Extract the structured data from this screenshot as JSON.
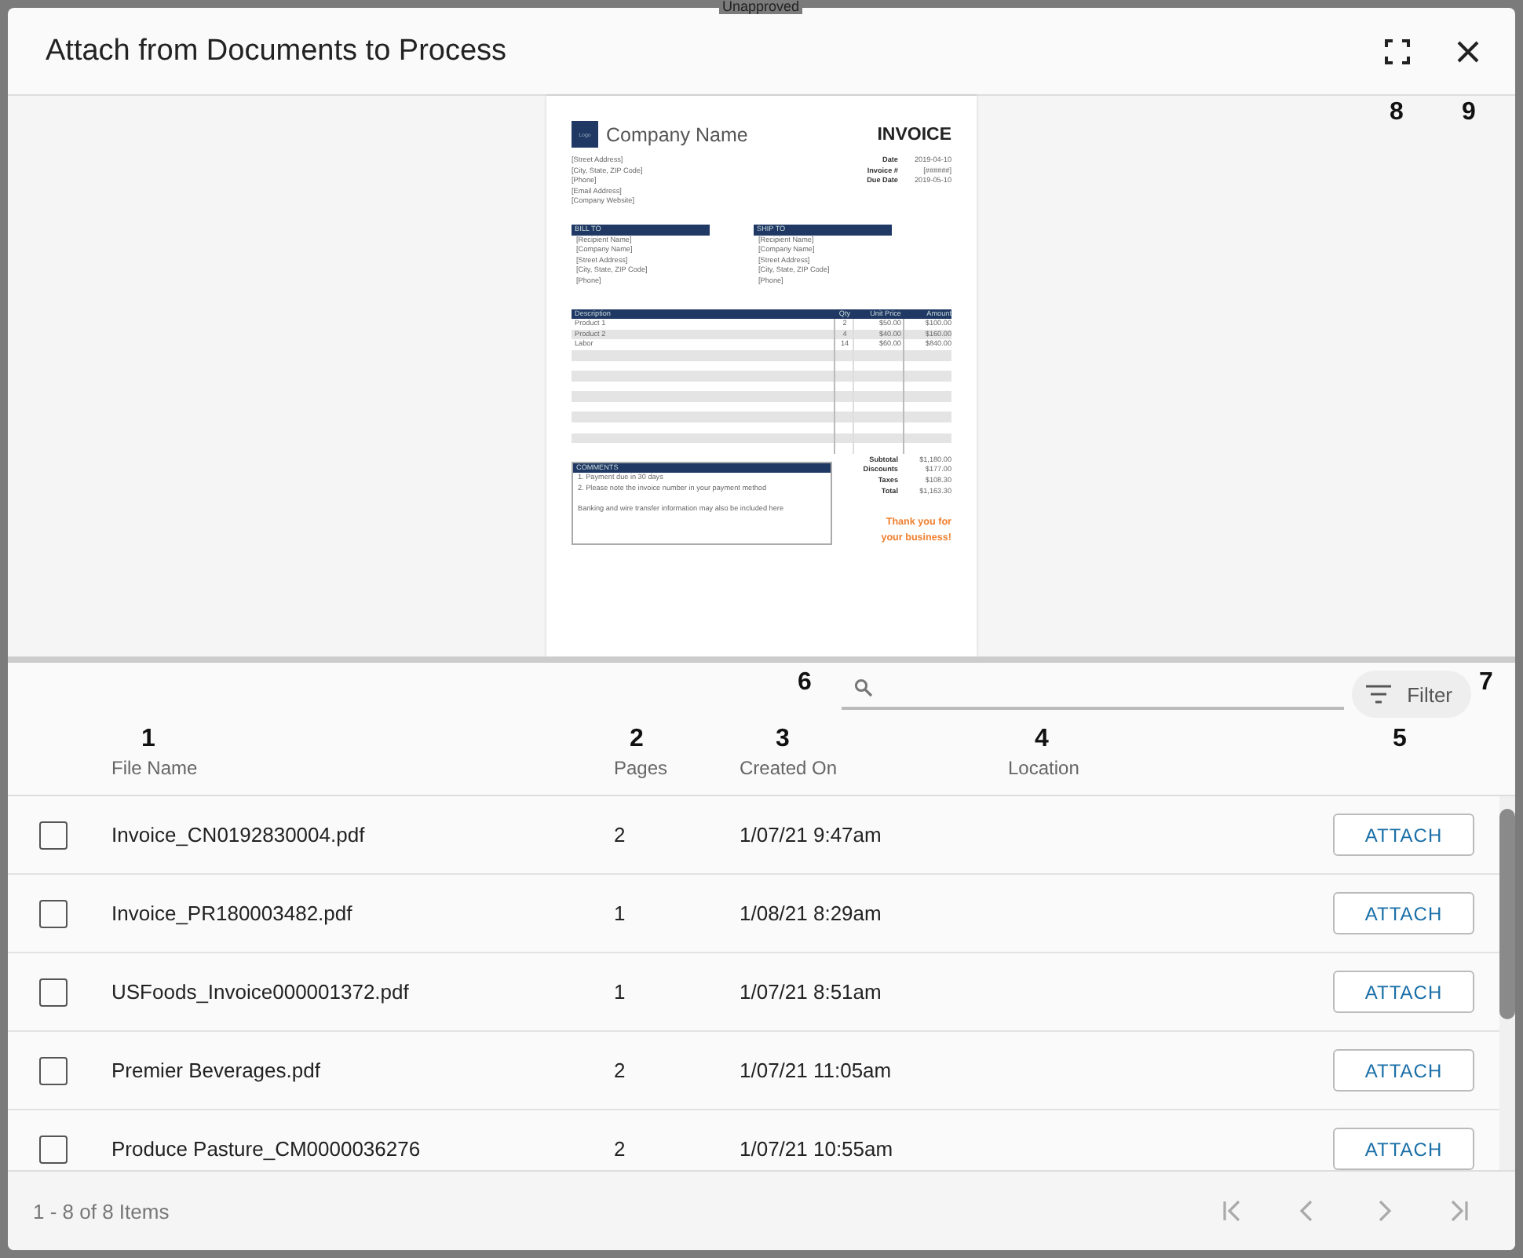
{
  "background": {
    "status_text": "Unapproved"
  },
  "dialog": {
    "title": "Attach from Documents to Process"
  },
  "preview": {
    "company_name": "Company Name",
    "logo_text": "Logo",
    "doc_title": "INVOICE",
    "address_lines": [
      "[Street Address]",
      "[City, State, ZIP Code]",
      "[Phone]",
      "[Email Address]",
      "[Company Website]"
    ],
    "meta": [
      {
        "label": "Date",
        "value": "2019-04-10"
      },
      {
        "label": "Invoice #",
        "value": "[######]"
      },
      {
        "label": "Due Date",
        "value": "2019-05-10"
      }
    ],
    "bill_to": {
      "heading": "BILL TO",
      "lines": [
        "[Recipient Name]",
        "[Company Name]",
        "[Street Address]",
        "[City, State, ZIP Code]",
        "[Phone]"
      ]
    },
    "ship_to": {
      "heading": "SHIP TO",
      "lines": [
        "[Recipient Name]",
        "[Company Name]",
        "[Street Address]",
        "[City, State, ZIP Code]",
        "[Phone]"
      ]
    },
    "items_columns": [
      "Description",
      "Qty",
      "Unit Price",
      "Amount"
    ],
    "items": [
      [
        "Product 1",
        "2",
        "$50.00",
        "$100.00"
      ],
      [
        "Product 2",
        "4",
        "$40.00",
        "$160.00"
      ],
      [
        "Labor",
        "14",
        "$60.00",
        "$840.00"
      ]
    ],
    "comments": {
      "heading": "COMMENTS",
      "lines": [
        "1. Payment due in 30 days",
        "2. Please note the invoice number in your payment method"
      ],
      "note": "Banking and wire transfer information may also be included here"
    },
    "totals": [
      {
        "label": "Subtotal",
        "value": "$1,180.00"
      },
      {
        "label": "Discounts",
        "value": "$177.00"
      },
      {
        "label": "Taxes",
        "value": "$108.30"
      },
      {
        "label": "Total",
        "value": "$1,163.30"
      }
    ],
    "thanks": [
      "Thank you for",
      "your business!"
    ]
  },
  "toolbar": {
    "filter_label": "Filter"
  },
  "table": {
    "columns": [
      "File Name",
      "Pages",
      "Created On",
      "Location"
    ],
    "rows": [
      {
        "checked": false,
        "file_name": "Invoice_CN0192830004.pdf",
        "pages": "2",
        "created_on": "1/07/21 9:47am",
        "action": "ATTACH"
      },
      {
        "checked": false,
        "file_name": "Invoice_PR180003482.pdf",
        "pages": "1",
        "created_on": "1/08/21 8:29am",
        "action": "ATTACH"
      },
      {
        "checked": false,
        "file_name": "USFoods_Invoice000001372.pdf",
        "pages": "1",
        "created_on": "1/07/21 8:51am",
        "action": "ATTACH"
      },
      {
        "checked": false,
        "file_name": "Premier Beverages.pdf",
        "pages": "2",
        "created_on": "1/07/21 11:05am",
        "action": "ATTACH"
      },
      {
        "checked": false,
        "file_name": "Produce Pasture_CM0000036276",
        "pages": "2",
        "created_on": "1/07/21 10:55am",
        "action": "ATTACH"
      }
    ]
  },
  "footer": {
    "summary": "1 - 8 of 8 Items"
  },
  "markers": [
    "8",
    "9",
    "6",
    "7",
    "1",
    "2",
    "3",
    "4",
    "5"
  ]
}
